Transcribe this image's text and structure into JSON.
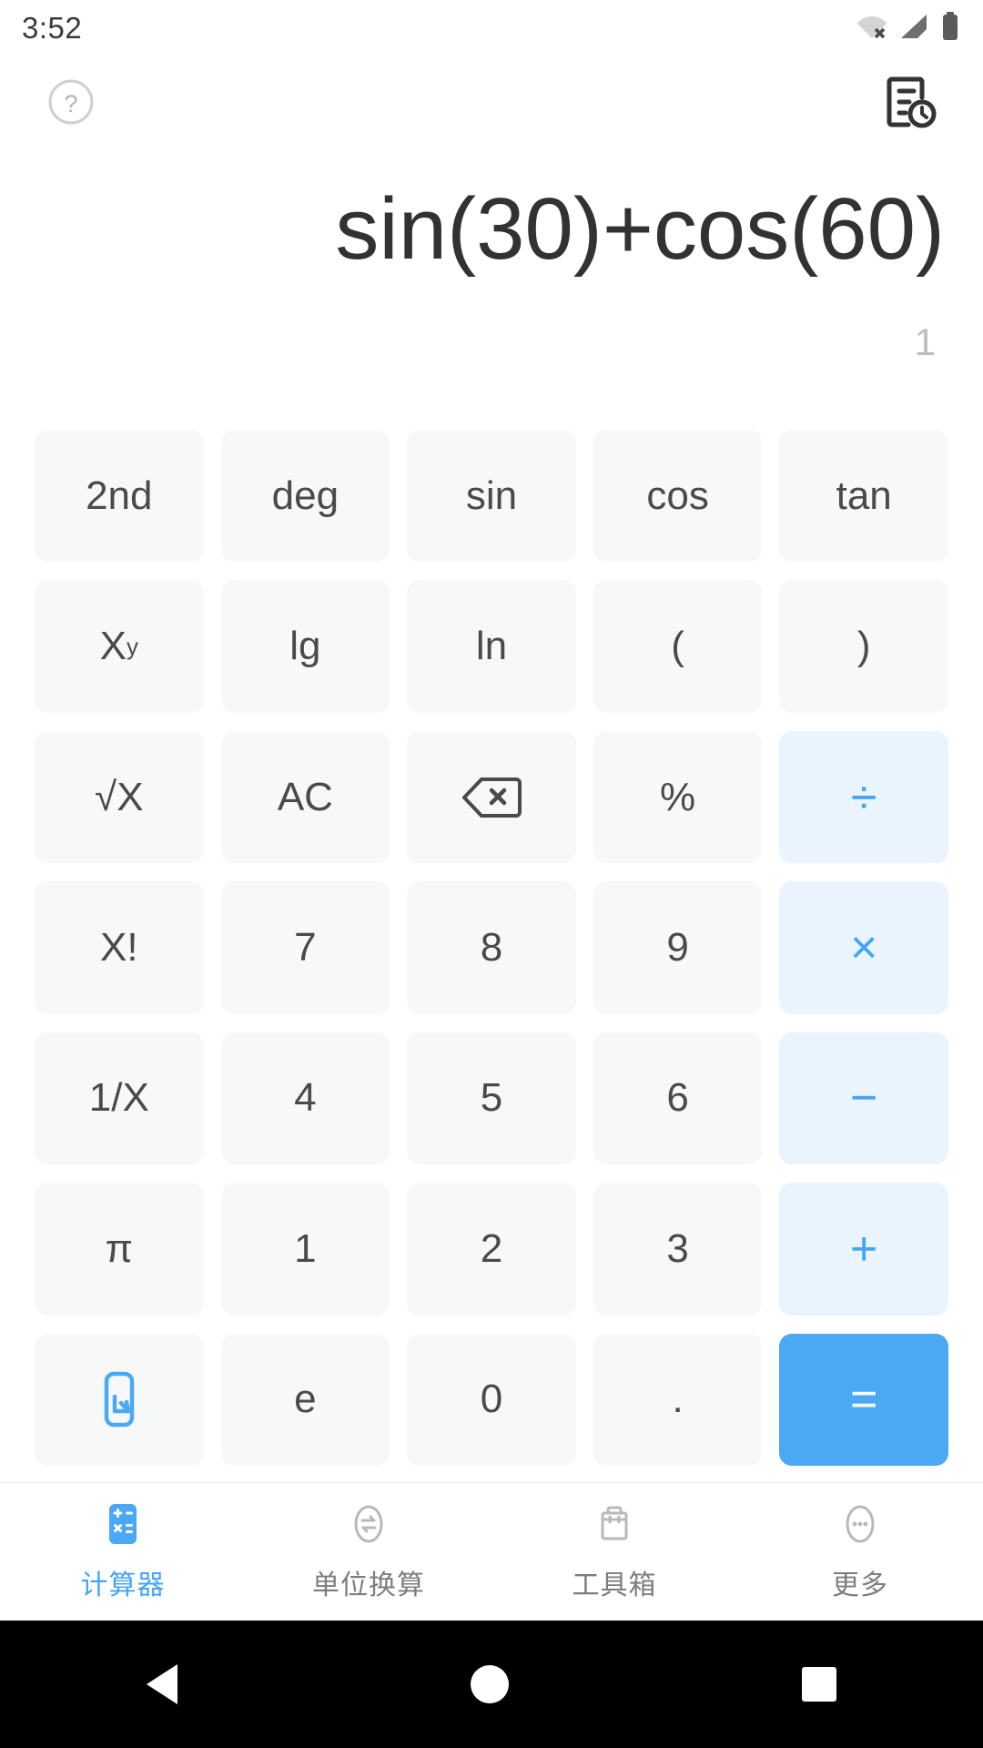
{
  "status_bar": {
    "time": "3:52",
    "icons": [
      "wifi-off-icon",
      "cellular-signal-icon",
      "battery-full-icon"
    ]
  },
  "top_bar": {
    "help_icon": "help-circle-icon",
    "history_icon": "history-document-icon"
  },
  "display": {
    "expression": "sin(30)+cos(60)",
    "result": "1"
  },
  "colors": {
    "accent": "#4aa8f5",
    "operator_bg": "#e9f4fe",
    "key_bg": "#f7f8f8",
    "text": "#4a4a4a",
    "result_text": "#bdbdbd"
  },
  "keypad": {
    "rows": [
      [
        {
          "label": "2nd",
          "name": "key-2nd",
          "type": "func"
        },
        {
          "label": "deg",
          "name": "key-deg",
          "type": "func"
        },
        {
          "label": "sin",
          "name": "key-sin",
          "type": "func"
        },
        {
          "label": "cos",
          "name": "key-cos",
          "type": "func"
        },
        {
          "label": "tan",
          "name": "key-tan",
          "type": "func"
        }
      ],
      [
        {
          "label": "X",
          "sup": "y",
          "name": "key-power",
          "type": "func"
        },
        {
          "label": "lg",
          "name": "key-lg",
          "type": "func"
        },
        {
          "label": "ln",
          "name": "key-ln",
          "type": "func"
        },
        {
          "label": "(",
          "name": "key-open-paren",
          "type": "func"
        },
        {
          "label": ")",
          "name": "key-close-paren",
          "type": "func"
        }
      ],
      [
        {
          "label": "√X",
          "name": "key-sqrt",
          "type": "func"
        },
        {
          "label": "AC",
          "name": "key-all-clear",
          "type": "func"
        },
        {
          "label": "",
          "name": "key-backspace",
          "type": "icon",
          "icon": "backspace-icon"
        },
        {
          "label": "%",
          "name": "key-percent",
          "type": "func"
        },
        {
          "label": "÷",
          "name": "key-divide",
          "type": "op"
        }
      ],
      [
        {
          "label": "X!",
          "name": "key-factorial",
          "type": "func"
        },
        {
          "label": "7",
          "name": "key-7",
          "type": "digit"
        },
        {
          "label": "8",
          "name": "key-8",
          "type": "digit"
        },
        {
          "label": "9",
          "name": "key-9",
          "type": "digit"
        },
        {
          "label": "×",
          "name": "key-multiply",
          "type": "op"
        }
      ],
      [
        {
          "label": "1/X",
          "name": "key-reciprocal",
          "type": "func"
        },
        {
          "label": "4",
          "name": "key-4",
          "type": "digit"
        },
        {
          "label": "5",
          "name": "key-5",
          "type": "digit"
        },
        {
          "label": "6",
          "name": "key-6",
          "type": "digit"
        },
        {
          "label": "−",
          "name": "key-minus",
          "type": "op"
        }
      ],
      [
        {
          "label": "π",
          "name": "key-pi",
          "type": "func"
        },
        {
          "label": "1",
          "name": "key-1",
          "type": "digit"
        },
        {
          "label": "2",
          "name": "key-2",
          "type": "digit"
        },
        {
          "label": "3",
          "name": "key-3",
          "type": "digit"
        },
        {
          "label": "+",
          "name": "key-plus",
          "type": "op"
        }
      ],
      [
        {
          "label": "",
          "name": "key-collapse-keypad",
          "type": "icon",
          "icon": "collapse-arrow-icon"
        },
        {
          "label": "e",
          "name": "key-e",
          "type": "digit"
        },
        {
          "label": "0",
          "name": "key-0",
          "type": "digit"
        },
        {
          "label": ".",
          "name": "key-decimal",
          "type": "digit"
        },
        {
          "label": "=",
          "name": "key-equals",
          "type": "equals"
        }
      ]
    ]
  },
  "tabs": [
    {
      "label": "计算器",
      "name": "tab-calculator",
      "icon": "calculator-icon",
      "active": true
    },
    {
      "label": "单位换算",
      "name": "tab-unit-conversion",
      "icon": "convert-icon",
      "active": false
    },
    {
      "label": "工具箱",
      "name": "tab-toolbox",
      "icon": "toolbox-icon",
      "active": false
    },
    {
      "label": "更多",
      "name": "tab-more",
      "icon": "more-dots-icon",
      "active": false
    }
  ],
  "android_nav": {
    "back": "back-triangle-icon",
    "home": "home-circle-icon",
    "recents": "recents-square-icon"
  }
}
